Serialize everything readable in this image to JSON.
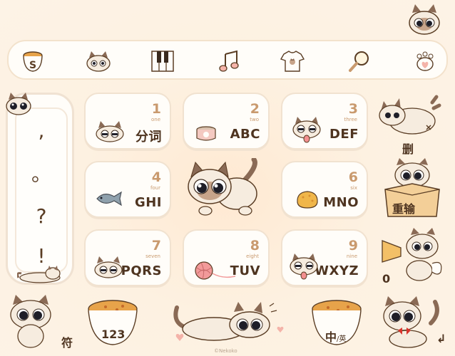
{
  "theme": {
    "background": "#fdf1e1",
    "key_fill": "#fffdf9",
    "key_border": "#f1e2d0",
    "accent_brown": "#c99a6e",
    "text_dark": "#4e3420",
    "cat_fur": "#f6ecdf",
    "cat_point": "#8a6a55"
  },
  "toolbar": {
    "items": [
      {
        "name": "emoji-s-bowl-icon"
      },
      {
        "name": "cat-face-icon"
      },
      {
        "name": "piano-keys-icon"
      },
      {
        "name": "music-note-icon"
      },
      {
        "name": "tshirt-icon"
      },
      {
        "name": "search-icon"
      },
      {
        "name": "paw-icon"
      }
    ]
  },
  "punctuation": {
    "items": [
      ",",
      "。",
      "?",
      "!"
    ]
  },
  "keys": [
    {
      "num": "1",
      "word": "one",
      "label": "分词"
    },
    {
      "num": "2",
      "word": "two",
      "label": "ABC"
    },
    {
      "num": "3",
      "word": "three",
      "label": "DEF"
    },
    {
      "num": "4",
      "word": "four",
      "label": "GHI"
    },
    {
      "num": "6",
      "word": "six",
      "label": "MNO"
    },
    {
      "num": "7",
      "word": "seven",
      "label": "PQRS"
    },
    {
      "num": "8",
      "word": "eight",
      "label": "TUV"
    },
    {
      "num": "9",
      "word": "nine",
      "label": "WXYZ"
    }
  ],
  "side": {
    "delete_label": "删",
    "retype_label": "重输",
    "zero_label": "0"
  },
  "bottom": {
    "symbol_label": "符",
    "numbers_label": "123",
    "lang_label_main": "中",
    "lang_label_sub": "/英",
    "enter_glyph": "↲"
  },
  "watermark": "©Nekoko"
}
